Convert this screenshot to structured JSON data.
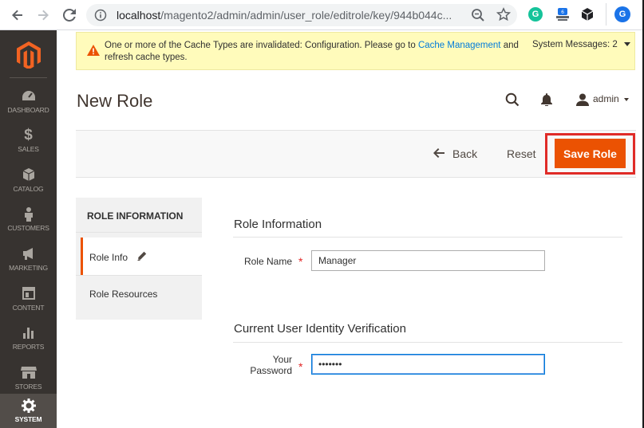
{
  "browser": {
    "url_host": "localhost",
    "url_path": "/magento2/admin/admin/user_role/editrole/key/944b044c...",
    "icons": [
      "back-arrow-icon",
      "forward-arrow-icon",
      "reload-icon",
      "info-icon",
      "zoom-icon",
      "star-icon",
      "grammarly-icon",
      "extension-icon",
      "cube-extension-icon",
      "profile-icon"
    ],
    "profile_initial": "G"
  },
  "sidebar": {
    "items": [
      {
        "label": "DASHBOARD",
        "icon": "dashboard-icon"
      },
      {
        "label": "SALES",
        "icon": "dollar-icon"
      },
      {
        "label": "CATALOG",
        "icon": "box-icon"
      },
      {
        "label": "CUSTOMERS",
        "icon": "person-icon"
      },
      {
        "label": "MARKETING",
        "icon": "megaphone-icon"
      },
      {
        "label": "CONTENT",
        "icon": "layout-icon"
      },
      {
        "label": "REPORTS",
        "icon": "bar-chart-icon"
      },
      {
        "label": "STORES",
        "icon": "storefront-icon"
      },
      {
        "label": "SYSTEM",
        "icon": "gear-icon",
        "active": true
      }
    ]
  },
  "message": {
    "text_before": "One or more of the Cache Types are invalidated: Configuration. Please go to ",
    "link": "Cache Management",
    "text_after": " and refresh cache types.",
    "system_messages": "System Messages: 2"
  },
  "header": {
    "title": "New Role",
    "user": "admin"
  },
  "actions": {
    "back": "Back",
    "reset": "Reset",
    "save": "Save Role"
  },
  "tabs": {
    "title": "ROLE INFORMATION",
    "items": [
      {
        "label": "Role Info",
        "active": true
      },
      {
        "label": "Role Resources",
        "active": false
      }
    ]
  },
  "form": {
    "section1": "Role Information",
    "role_name_label": "Role Name",
    "role_name_value": "Manager",
    "section2": "Current User Identity Verification",
    "password_label_line1": "Your",
    "password_label_line2": "Password",
    "password_value": "•••••••"
  },
  "colors": {
    "accent": "#eb5202",
    "sidebar": "#373330",
    "highlight_border": "#e02b27",
    "link": "#007bdb"
  }
}
